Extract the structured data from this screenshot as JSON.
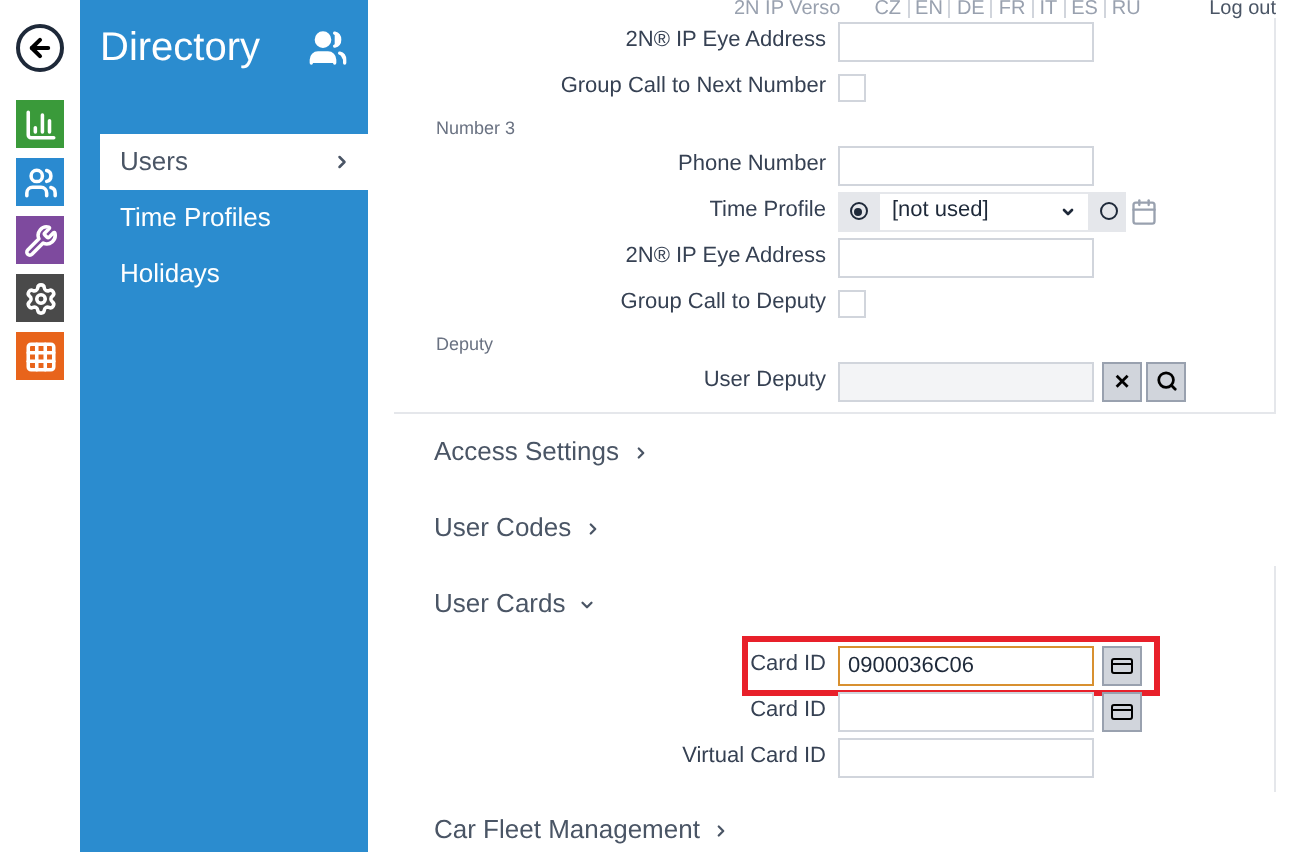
{
  "header": {
    "product": "2N IP Verso",
    "languages": [
      "CZ",
      "EN",
      "DE",
      "FR",
      "IT",
      "ES",
      "RU"
    ],
    "logout": "Log out"
  },
  "nav_icons": [
    {
      "kind": "chart",
      "color": "#3a9a3a"
    },
    {
      "kind": "users",
      "color": "#2a8ad0"
    },
    {
      "kind": "tools",
      "color": "#7e4a9e"
    },
    {
      "kind": "settings",
      "color": "#4a4a4a"
    },
    {
      "kind": "grid",
      "color": "#e8641b"
    }
  ],
  "sidebar": {
    "title": "Directory",
    "items": [
      {
        "label": "Users",
        "selected": true
      },
      {
        "label": "Time Profiles",
        "selected": false
      },
      {
        "label": "Holidays",
        "selected": false
      }
    ]
  },
  "groups": [
    {
      "fields": [
        {
          "kind": "text",
          "label": "2N® IP Eye Address"
        },
        {
          "kind": "checkbox",
          "label": "Group Call to Next Number",
          "checked": false
        }
      ]
    },
    {
      "title": "Number 3",
      "fields": [
        {
          "kind": "text",
          "label": "Phone Number"
        },
        {
          "kind": "time_profile",
          "label": "Time Profile",
          "value": "[not used]",
          "selected": true
        },
        {
          "kind": "text",
          "label": "2N® IP Eye Address"
        },
        {
          "kind": "checkbox",
          "label": "Group Call to Deputy",
          "checked": false
        }
      ]
    },
    {
      "title": "Deputy",
      "fields": [
        {
          "kind": "deputy",
          "label": "User Deputy",
          "close": "×"
        }
      ]
    }
  ],
  "sections": [
    {
      "title": "Access Settings",
      "expanded": false
    },
    {
      "title": "User Codes",
      "expanded": false
    },
    {
      "title": "User Cards",
      "expanded": true,
      "fields": [
        {
          "kind": "card",
          "label": "Card ID",
          "value": "0900036C06",
          "highlighted": true
        },
        {
          "kind": "card",
          "label": "Card ID",
          "highlighted": false
        },
        {
          "kind": "text",
          "label": "Virtual Card ID"
        }
      ]
    },
    {
      "title": "Car Fleet Management",
      "expanded": false
    }
  ]
}
